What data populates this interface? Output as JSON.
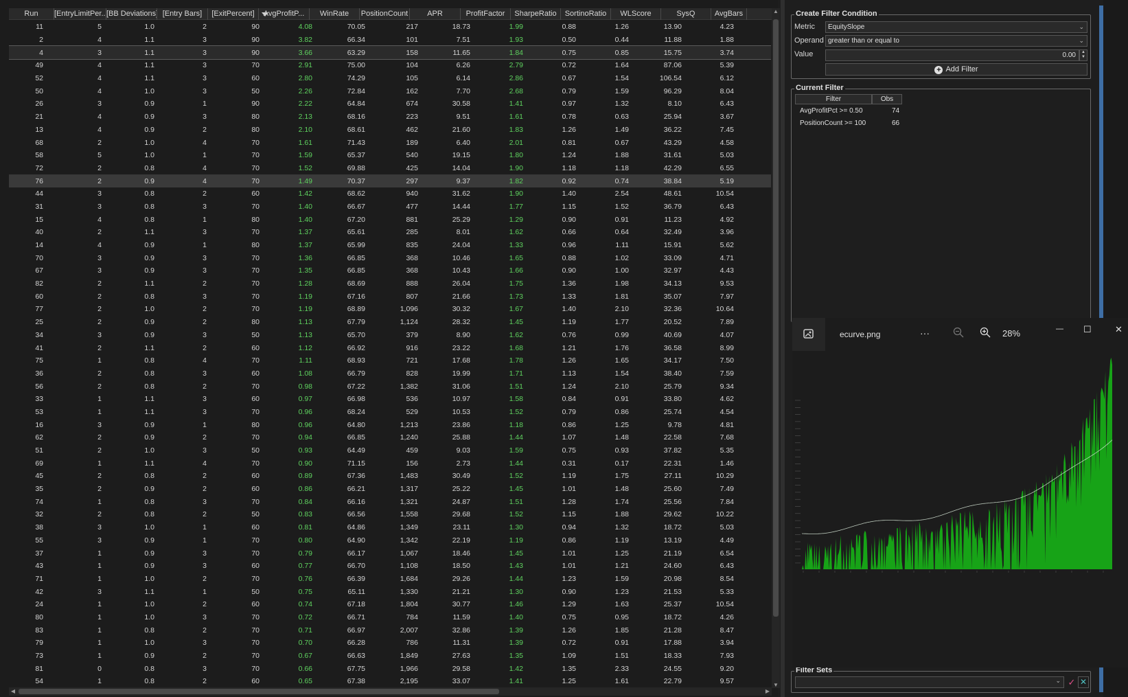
{
  "grid": {
    "columns": [
      "Run",
      "[EntryLimitPer...",
      "[BB Deviations]",
      "[Entry Bars]",
      "[ExitPercent]",
      "AvgProfitP...",
      "WinRate",
      "PositionCount",
      "APR",
      "ProfitFactor",
      "SharpeRatio",
      "SortinoRatio",
      "WLScore",
      "SysQ",
      "AvgBars"
    ],
    "sorted_column": "AvgProfitP...",
    "rows": [
      [
        "11",
        "5",
        "1.0",
        "2",
        "90",
        "4.08",
        "70.05",
        "217",
        "18.73",
        "1.99",
        "0.88",
        "1.26",
        "13.90",
        "4.23"
      ],
      [
        "2",
        "4",
        "1.1",
        "3",
        "90",
        "3.82",
        "66.34",
        "101",
        "7.51",
        "1.93",
        "0.50",
        "0.44",
        "11.88",
        "1.88"
      ],
      [
        "4",
        "3",
        "1.1",
        "3",
        "90",
        "3.66",
        "63.29",
        "158",
        "11.65",
        "1.84",
        "0.75",
        "0.85",
        "15.75",
        "3.74"
      ],
      [
        "49",
        "4",
        "1.1",
        "3",
        "70",
        "2.91",
        "75.00",
        "104",
        "6.26",
        "2.79",
        "0.72",
        "1.64",
        "87.06",
        "5.39"
      ],
      [
        "52",
        "4",
        "1.1",
        "3",
        "60",
        "2.80",
        "74.29",
        "105",
        "6.14",
        "2.86",
        "0.67",
        "1.54",
        "106.54",
        "6.12"
      ],
      [
        "50",
        "4",
        "1.0",
        "3",
        "50",
        "2.26",
        "72.84",
        "162",
        "7.70",
        "2.68",
        "0.79",
        "1.59",
        "96.29",
        "8.04"
      ],
      [
        "26",
        "3",
        "0.9",
        "1",
        "90",
        "2.22",
        "64.84",
        "674",
        "30.58",
        "1.41",
        "0.97",
        "1.32",
        "8.10",
        "6.43"
      ],
      [
        "21",
        "4",
        "0.9",
        "3",
        "80",
        "2.13",
        "68.16",
        "223",
        "9.51",
        "1.61",
        "0.78",
        "0.63",
        "25.94",
        "3.67"
      ],
      [
        "13",
        "4",
        "0.9",
        "2",
        "80",
        "2.10",
        "68.61",
        "462",
        "21.60",
        "1.83",
        "1.26",
        "1.49",
        "36.22",
        "7.45"
      ],
      [
        "68",
        "2",
        "1.0",
        "4",
        "70",
        "1.61",
        "71.43",
        "189",
        "6.40",
        "2.01",
        "0.81",
        "0.67",
        "43.29",
        "4.58"
      ],
      [
        "58",
        "5",
        "1.0",
        "1",
        "70",
        "1.59",
        "65.37",
        "540",
        "19.15",
        "1.80",
        "1.24",
        "1.88",
        "31.61",
        "5.03"
      ],
      [
        "72",
        "2",
        "0.8",
        "4",
        "70",
        "1.52",
        "69.88",
        "425",
        "14.04",
        "1.90",
        "1.18",
        "1.18",
        "42.29",
        "6.55"
      ],
      [
        "76",
        "2",
        "0.9",
        "4",
        "70",
        "1.49",
        "70.37",
        "297",
        "9.37",
        "1.82",
        "0.92",
        "0.74",
        "38.84",
        "5.19"
      ],
      [
        "44",
        "3",
        "0.8",
        "2",
        "60",
        "1.42",
        "68.62",
        "940",
        "31.62",
        "1.90",
        "1.40",
        "2.54",
        "48.61",
        "10.54"
      ],
      [
        "31",
        "3",
        "0.8",
        "3",
        "70",
        "1.40",
        "66.67",
        "477",
        "14.44",
        "1.77",
        "1.15",
        "1.52",
        "36.79",
        "6.43"
      ],
      [
        "15",
        "4",
        "0.8",
        "1",
        "80",
        "1.40",
        "67.20",
        "881",
        "25.29",
        "1.29",
        "0.90",
        "0.91",
        "11.23",
        "4.92"
      ],
      [
        "40",
        "2",
        "1.1",
        "3",
        "70",
        "1.37",
        "65.61",
        "285",
        "8.01",
        "1.62",
        "0.66",
        "0.64",
        "32.49",
        "3.96"
      ],
      [
        "14",
        "4",
        "0.9",
        "1",
        "80",
        "1.37",
        "65.99",
        "835",
        "24.04",
        "1.33",
        "0.96",
        "1.11",
        "15.91",
        "5.62"
      ],
      [
        "70",
        "3",
        "0.9",
        "3",
        "70",
        "1.36",
        "66.85",
        "368",
        "10.46",
        "1.65",
        "0.88",
        "1.02",
        "33.09",
        "4.71"
      ],
      [
        "67",
        "3",
        "0.9",
        "3",
        "70",
        "1.35",
        "66.85",
        "368",
        "10.43",
        "1.66",
        "0.90",
        "1.00",
        "32.97",
        "4.43"
      ],
      [
        "82",
        "2",
        "1.1",
        "2",
        "70",
        "1.28",
        "68.69",
        "888",
        "26.04",
        "1.75",
        "1.36",
        "1.98",
        "34.13",
        "9.53"
      ],
      [
        "60",
        "2",
        "0.8",
        "3",
        "70",
        "1.19",
        "67.16",
        "807",
        "21.66",
        "1.73",
        "1.33",
        "1.81",
        "35.07",
        "7.97"
      ],
      [
        "77",
        "2",
        "1.0",
        "2",
        "70",
        "1.19",
        "68.89",
        "1,096",
        "30.32",
        "1.67",
        "1.40",
        "2.10",
        "32.36",
        "10.64"
      ],
      [
        "25",
        "2",
        "0.9",
        "2",
        "80",
        "1.13",
        "67.79",
        "1,124",
        "28.32",
        "1.45",
        "1.19",
        "1.77",
        "20.52",
        "7.89"
      ],
      [
        "34",
        "3",
        "0.9",
        "3",
        "50",
        "1.13",
        "65.70",
        "379",
        "8.90",
        "1.62",
        "0.76",
        "0.99",
        "40.69",
        "4.07"
      ],
      [
        "41",
        "2",
        "1.1",
        "2",
        "60",
        "1.12",
        "66.92",
        "916",
        "23.22",
        "1.68",
        "1.21",
        "1.76",
        "36.58",
        "8.99"
      ],
      [
        "75",
        "1",
        "0.8",
        "4",
        "70",
        "1.11",
        "68.93",
        "721",
        "17.68",
        "1.78",
        "1.26",
        "1.65",
        "34.17",
        "7.50"
      ],
      [
        "36",
        "2",
        "0.8",
        "3",
        "60",
        "1.08",
        "66.79",
        "828",
        "19.99",
        "1.71",
        "1.13",
        "1.54",
        "38.40",
        "7.59"
      ],
      [
        "56",
        "2",
        "0.8",
        "2",
        "70",
        "0.98",
        "67.22",
        "1,382",
        "31.06",
        "1.51",
        "1.24",
        "2.10",
        "25.79",
        "9.34"
      ],
      [
        "33",
        "1",
        "1.1",
        "3",
        "60",
        "0.97",
        "66.98",
        "536",
        "10.97",
        "1.58",
        "0.84",
        "0.91",
        "33.80",
        "4.62"
      ],
      [
        "53",
        "1",
        "1.1",
        "3",
        "70",
        "0.96",
        "68.24",
        "529",
        "10.53",
        "1.52",
        "0.79",
        "0.86",
        "25.74",
        "4.54"
      ],
      [
        "16",
        "3",
        "0.9",
        "1",
        "80",
        "0.96",
        "64.80",
        "1,213",
        "23.86",
        "1.18",
        "0.86",
        "1.25",
        "9.78",
        "4.81"
      ],
      [
        "62",
        "2",
        "0.9",
        "2",
        "70",
        "0.94",
        "66.85",
        "1,240",
        "25.88",
        "1.44",
        "1.07",
        "1.48",
        "22.58",
        "7.68"
      ],
      [
        "51",
        "2",
        "1.0",
        "3",
        "50",
        "0.93",
        "64.49",
        "459",
        "9.03",
        "1.59",
        "0.75",
        "0.93",
        "37.82",
        "5.35"
      ],
      [
        "69",
        "1",
        "1.1",
        "4",
        "70",
        "0.90",
        "71.15",
        "156",
        "2.73",
        "1.44",
        "0.31",
        "0.17",
        "22.31",
        "1.46"
      ],
      [
        "45",
        "2",
        "0.8",
        "2",
        "60",
        "0.89",
        "67.36",
        "1,483",
        "30.49",
        "1.52",
        "1.19",
        "1.75",
        "27.11",
        "10.29"
      ],
      [
        "35",
        "2",
        "0.9",
        "2",
        "60",
        "0.86",
        "66.21",
        "1,317",
        "25.22",
        "1.45",
        "1.01",
        "1.48",
        "25.60",
        "7.49"
      ],
      [
        "74",
        "1",
        "0.8",
        "3",
        "70",
        "0.84",
        "66.16",
        "1,321",
        "24.87",
        "1.51",
        "1.28",
        "1.74",
        "25.56",
        "7.84"
      ],
      [
        "32",
        "2",
        "0.8",
        "2",
        "50",
        "0.83",
        "66.56",
        "1,558",
        "29.68",
        "1.52",
        "1.15",
        "1.88",
        "29.62",
        "10.22"
      ],
      [
        "38",
        "3",
        "1.0",
        "1",
        "60",
        "0.81",
        "64.86",
        "1,349",
        "23.11",
        "1.30",
        "0.94",
        "1.32",
        "18.72",
        "5.03"
      ],
      [
        "55",
        "3",
        "0.9",
        "1",
        "70",
        "0.80",
        "64.90",
        "1,342",
        "22.19",
        "1.19",
        "0.86",
        "1.19",
        "13.19",
        "4.49"
      ],
      [
        "37",
        "1",
        "0.9",
        "3",
        "70",
        "0.79",
        "66.17",
        "1,067",
        "18.46",
        "1.45",
        "1.01",
        "1.25",
        "21.19",
        "6.54"
      ],
      [
        "43",
        "1",
        "0.9",
        "3",
        "60",
        "0.77",
        "66.70",
        "1,108",
        "18.50",
        "1.43",
        "1.01",
        "1.21",
        "24.60",
        "6.43"
      ],
      [
        "71",
        "1",
        "1.0",
        "2",
        "70",
        "0.76",
        "66.39",
        "1,684",
        "29.26",
        "1.44",
        "1.23",
        "1.59",
        "20.98",
        "8.54"
      ],
      [
        "42",
        "3",
        "1.1",
        "1",
        "50",
        "0.75",
        "65.11",
        "1,330",
        "21.21",
        "1.30",
        "0.90",
        "1.23",
        "21.53",
        "5.33"
      ],
      [
        "24",
        "1",
        "1.0",
        "2",
        "60",
        "0.74",
        "67.18",
        "1,804",
        "30.77",
        "1.46",
        "1.29",
        "1.63",
        "25.37",
        "10.54"
      ],
      [
        "80",
        "1",
        "1.0",
        "3",
        "70",
        "0.72",
        "66.71",
        "784",
        "11.59",
        "1.40",
        "0.75",
        "0.95",
        "18.72",
        "4.26"
      ],
      [
        "83",
        "1",
        "0.8",
        "2",
        "70",
        "0.71",
        "66.97",
        "2,007",
        "32.86",
        "1.39",
        "1.26",
        "1.85",
        "21.28",
        "8.47"
      ],
      [
        "79",
        "1",
        "1.0",
        "3",
        "70",
        "0.70",
        "66.28",
        "786",
        "11.31",
        "1.39",
        "0.72",
        "0.91",
        "17.88",
        "3.94"
      ],
      [
        "73",
        "1",
        "0.9",
        "2",
        "70",
        "0.67",
        "66.63",
        "1,849",
        "27.63",
        "1.35",
        "1.09",
        "1.51",
        "18.33",
        "7.93"
      ],
      [
        "81",
        "0",
        "0.8",
        "3",
        "70",
        "0.66",
        "67.75",
        "1,966",
        "29.58",
        "1.42",
        "1.35",
        "2.33",
        "24.55",
        "9.20"
      ],
      [
        "54",
        "1",
        "0.8",
        "2",
        "60",
        "0.65",
        "67.38",
        "2,195",
        "33.07",
        "1.41",
        "1.25",
        "1.61",
        "22.79",
        "9.57"
      ]
    ]
  },
  "create_filter": {
    "title": "Create Filter Condition",
    "metric_label": "Metric",
    "metric_value": "EquitySlope",
    "operand_label": "Operand",
    "operand_value": "greater than or equal to",
    "value_label": "Value",
    "value_value": "0.00",
    "add_button": "Add Filter"
  },
  "current_filter": {
    "title": "Current Filter",
    "headers": [
      "Filter",
      "Obs"
    ],
    "rows": [
      {
        "filter": "AvgProfitPct >= 0.50",
        "obs": "74"
      },
      {
        "filter": "PositionCount >= 100",
        "obs": "66"
      }
    ]
  },
  "viewer": {
    "filename": "ecurve.png",
    "more": "···",
    "zoom": "28%",
    "minimize": "—",
    "maximize": "☐",
    "close": "✕"
  },
  "filter_sets": {
    "title": "Filter Sets",
    "value": ""
  },
  "colors": {
    "positive_green": "#5fd25f",
    "accent_blue": "#3e6ea5",
    "chart_green": "#17a317"
  }
}
